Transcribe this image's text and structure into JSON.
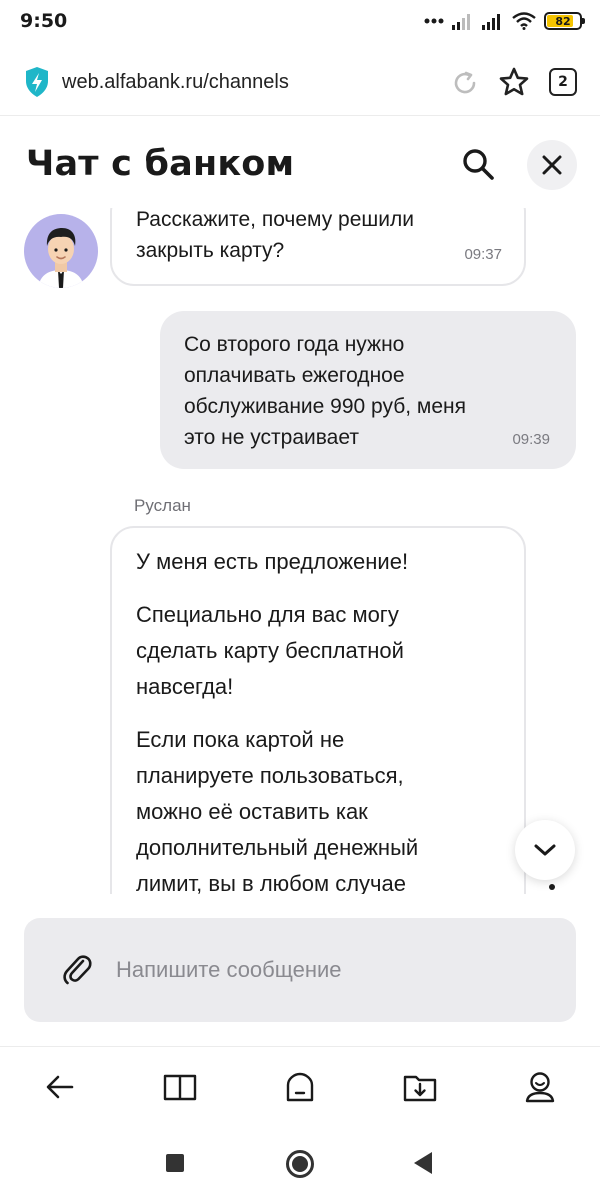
{
  "status_bar": {
    "time": "9:50",
    "battery": "82",
    "battery_level": 0.82,
    "icons": [
      "more-dots-icon",
      "signal-icon",
      "signal-icon",
      "wifi-icon",
      "battery-icon"
    ]
  },
  "browser": {
    "url": "web.alfabank.ru/channels",
    "tab_count": "2",
    "icons": {
      "secure": "shield-bolt-icon",
      "reload": "reload-icon",
      "bookmark": "star-icon"
    }
  },
  "chat": {
    "title": "Чат с банком",
    "messages": [
      {
        "direction": "incoming",
        "lines": [
          "Расскажите, почему решили",
          "закрыть карту?"
        ],
        "time": "09:37"
      },
      {
        "direction": "outgoing",
        "lines": [
          "Со второго года нужно",
          "оплачивать ежегодное",
          "обслуживание 990 руб, меня",
          "это не устраивает"
        ],
        "time": "09:39"
      },
      {
        "direction": "incoming",
        "sender": "Руслан",
        "paragraphs": [
          {
            "lines": [
              "У меня есть предложение!"
            ]
          },
          {
            "lines": [
              "Специально для вас могу",
              "сделать карту бесплатной",
              "навсегда!"
            ]
          },
          {
            "lines": [
              "Если пока картой не",
              "планируете пользоваться,",
              "можно её оставить как",
              "дополнительный денежный",
              "лимит, вы в любом случае"
            ]
          }
        ]
      }
    ]
  },
  "composer": {
    "placeholder": "Напишите сообщение"
  },
  "colors": {
    "accent": "#1fb6c8",
    "bubble_outgoing": "#ebebee",
    "bubble_border": "#e6e6e9",
    "avatar_bg": "#b7b2ea",
    "battery_fill": "#f5c400"
  },
  "bottom_nav": [
    "back-arrow-icon",
    "book-icon",
    "home-icon",
    "downloads-icon",
    "profile-icon"
  ]
}
